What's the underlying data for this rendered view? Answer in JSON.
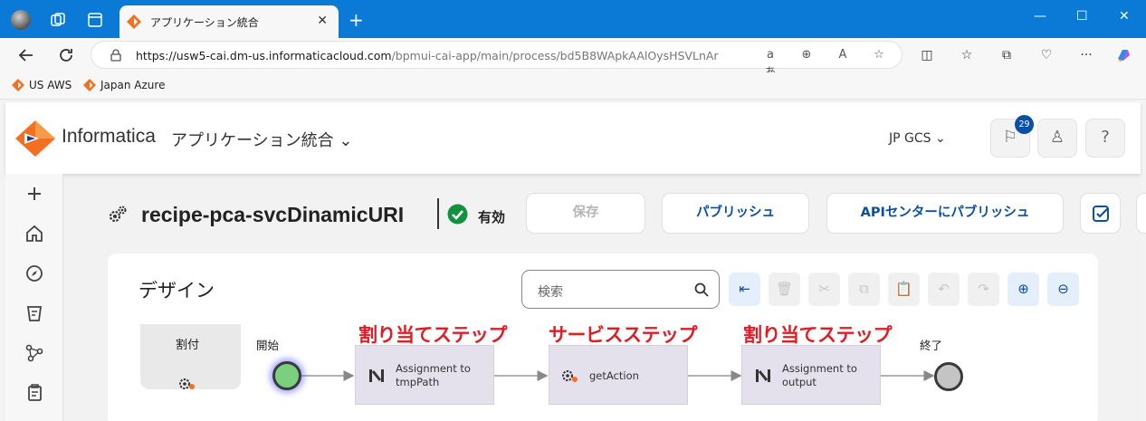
{
  "browser": {
    "tab_title": "アプリケーション統合",
    "url_host": "https://usw5-cai.dm-us.informaticacloud.com",
    "url_path": "/bpmui-cai-app/main/process/bd5B8WApkAAlOysHSVLnAr",
    "favorites": [
      "US AWS",
      "Japan Azure"
    ]
  },
  "header": {
    "brand": "Informatica",
    "product": "アプリケーション統合",
    "org": "JP GCS",
    "notification_count": "29"
  },
  "process": {
    "name": "recipe-pca-svcDinamicURI",
    "status": "有効",
    "buttons": {
      "save": "保存",
      "publish": "パブリッシュ",
      "api_publish": "APIセンターにパブリッシュ"
    }
  },
  "design": {
    "title": "デザイン",
    "search_placeholder": "検索",
    "palette_label": "割付",
    "start_label": "開始",
    "end_label": "終了",
    "steps": [
      {
        "label_line1": "Assignment to",
        "label_line2": "tmpPath",
        "annotation": "割り当てステップ"
      },
      {
        "label_line1": "getAction",
        "label_line2": "",
        "annotation": "サービスステップ"
      },
      {
        "label_line1": "Assignment to",
        "label_line2": "output",
        "annotation": "割り当てステップ"
      }
    ]
  },
  "colors": {
    "browser_chrome": "#0a7ad6",
    "brand_blue": "#0b4fa6",
    "annotation_red": "#e21c24",
    "step_fill": "#e4e0ec",
    "start_fill": "#7bd07e",
    "end_fill": "#c4c4c4"
  },
  "icons": {
    "left_nav": [
      "plus-icon",
      "home-icon",
      "explore-icon",
      "bucket-icon",
      "graph-icon",
      "clipboard-icon"
    ],
    "toolbar": [
      "collapse-left-icon",
      "trash-icon",
      "cut-icon",
      "copy-icon",
      "paste-icon",
      "undo-icon",
      "redo-icon",
      "zoom-in-icon",
      "zoom-out-icon"
    ]
  }
}
